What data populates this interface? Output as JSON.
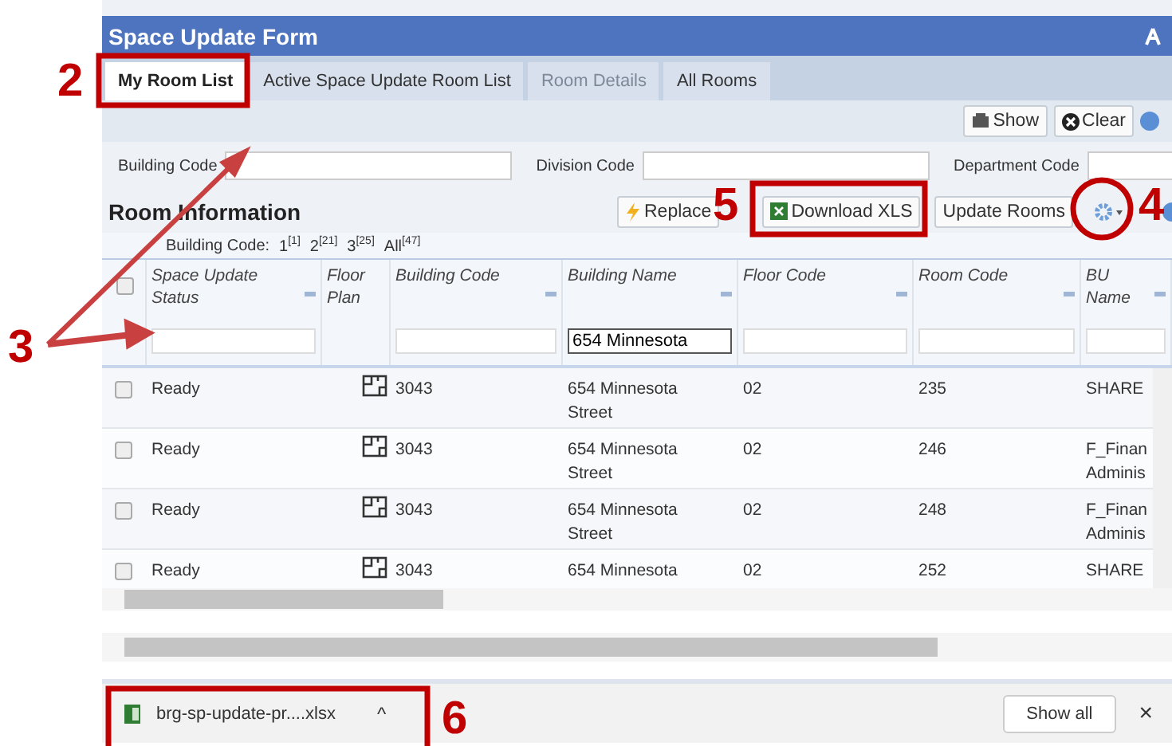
{
  "window": {
    "title": "Space Update Form"
  },
  "tabs": [
    {
      "label": "My Room List",
      "selected": true,
      "disabled": false
    },
    {
      "label": "Active Space Update Room List",
      "selected": false,
      "disabled": false
    },
    {
      "label": "Room Details",
      "selected": false,
      "disabled": true
    },
    {
      "label": "All Rooms",
      "selected": false,
      "disabled": false
    }
  ],
  "toolbar": {
    "buttons": [
      {
        "label": "Show",
        "kind": "show"
      },
      {
        "label": "Clear",
        "kind": "clear"
      }
    ]
  },
  "filters": [
    {
      "label": "Building Code"
    },
    {
      "label": "Division Code"
    },
    {
      "label": "Department Code"
    }
  ],
  "room_information": {
    "title": "Room Information",
    "buttons": [
      {
        "label": "Replace",
        "kind": "replace"
      },
      {
        "label": "Download XLS",
        "kind": "excel"
      },
      {
        "label": "Update Rooms",
        "kind": "plain"
      },
      {
        "kind": "gear"
      }
    ],
    "counts_label": "Building Code:",
    "counts": [
      "1$^{[1]}$",
      "2$^{[21]}$",
      "3$^{[25]}$",
      "All$^{[47]}$"
    ]
  },
  "table": {
    "select_all_checked": false,
    "columns": [
      {
        "label": "Space Update Status",
        "filter": true
      },
      {
        "label": "Floor Plan",
        "filter": false
      },
      {
        "label": "Building Code",
        "filter": true
      },
      {
        "label": "Building Name",
        "filter": true,
        "value": "654 Minnesota"
      },
      {
        "label": "Floor Code",
        "filter": true
      },
      {
        "label": "Room Code",
        "filter": true
      },
      {
        "label": "BU Name",
        "filter": true
      }
    ],
    "rows": [
      {
        "checked": false,
        "status": "Ready",
        "building_code": "3043",
        "building_name": "654 Minnesota Street",
        "floor_code": "02",
        "room_code": "235",
        "bu_name": "SHARE"
      },
      {
        "checked": false,
        "status": "Ready",
        "building_code": "3043",
        "building_name": "654 Minnesota Street",
        "floor_code": "02",
        "room_code": "246",
        "bu_name": "F_Finan Adminis"
      },
      {
        "checked": false,
        "status": "Ready",
        "building_code": "3043",
        "building_name": "654 Minnesota Street",
        "floor_code": "02",
        "room_code": "248",
        "bu_name": "F_Finan Adminis"
      },
      {
        "checked": false,
        "status": "Ready",
        "building_code": "3043",
        "building_name": "654 Minnesota",
        "floor_code": "02",
        "room_code": "252",
        "bu_name": "SHARE"
      }
    ]
  },
  "download_bar": {
    "file": "brg-sp-update-pr....xlsx",
    "caret": "^",
    "show_all": "Show all",
    "close": "×"
  },
  "callouts": [
    {
      "label": "2",
      "kind": "box"
    },
    {
      "label": "3",
      "kind": "arrows"
    },
    {
      "label": "4",
      "kind": "circle"
    },
    {
      "label": "5",
      "kind": "box"
    },
    {
      "label": "6",
      "kind": "box"
    }
  ]
}
